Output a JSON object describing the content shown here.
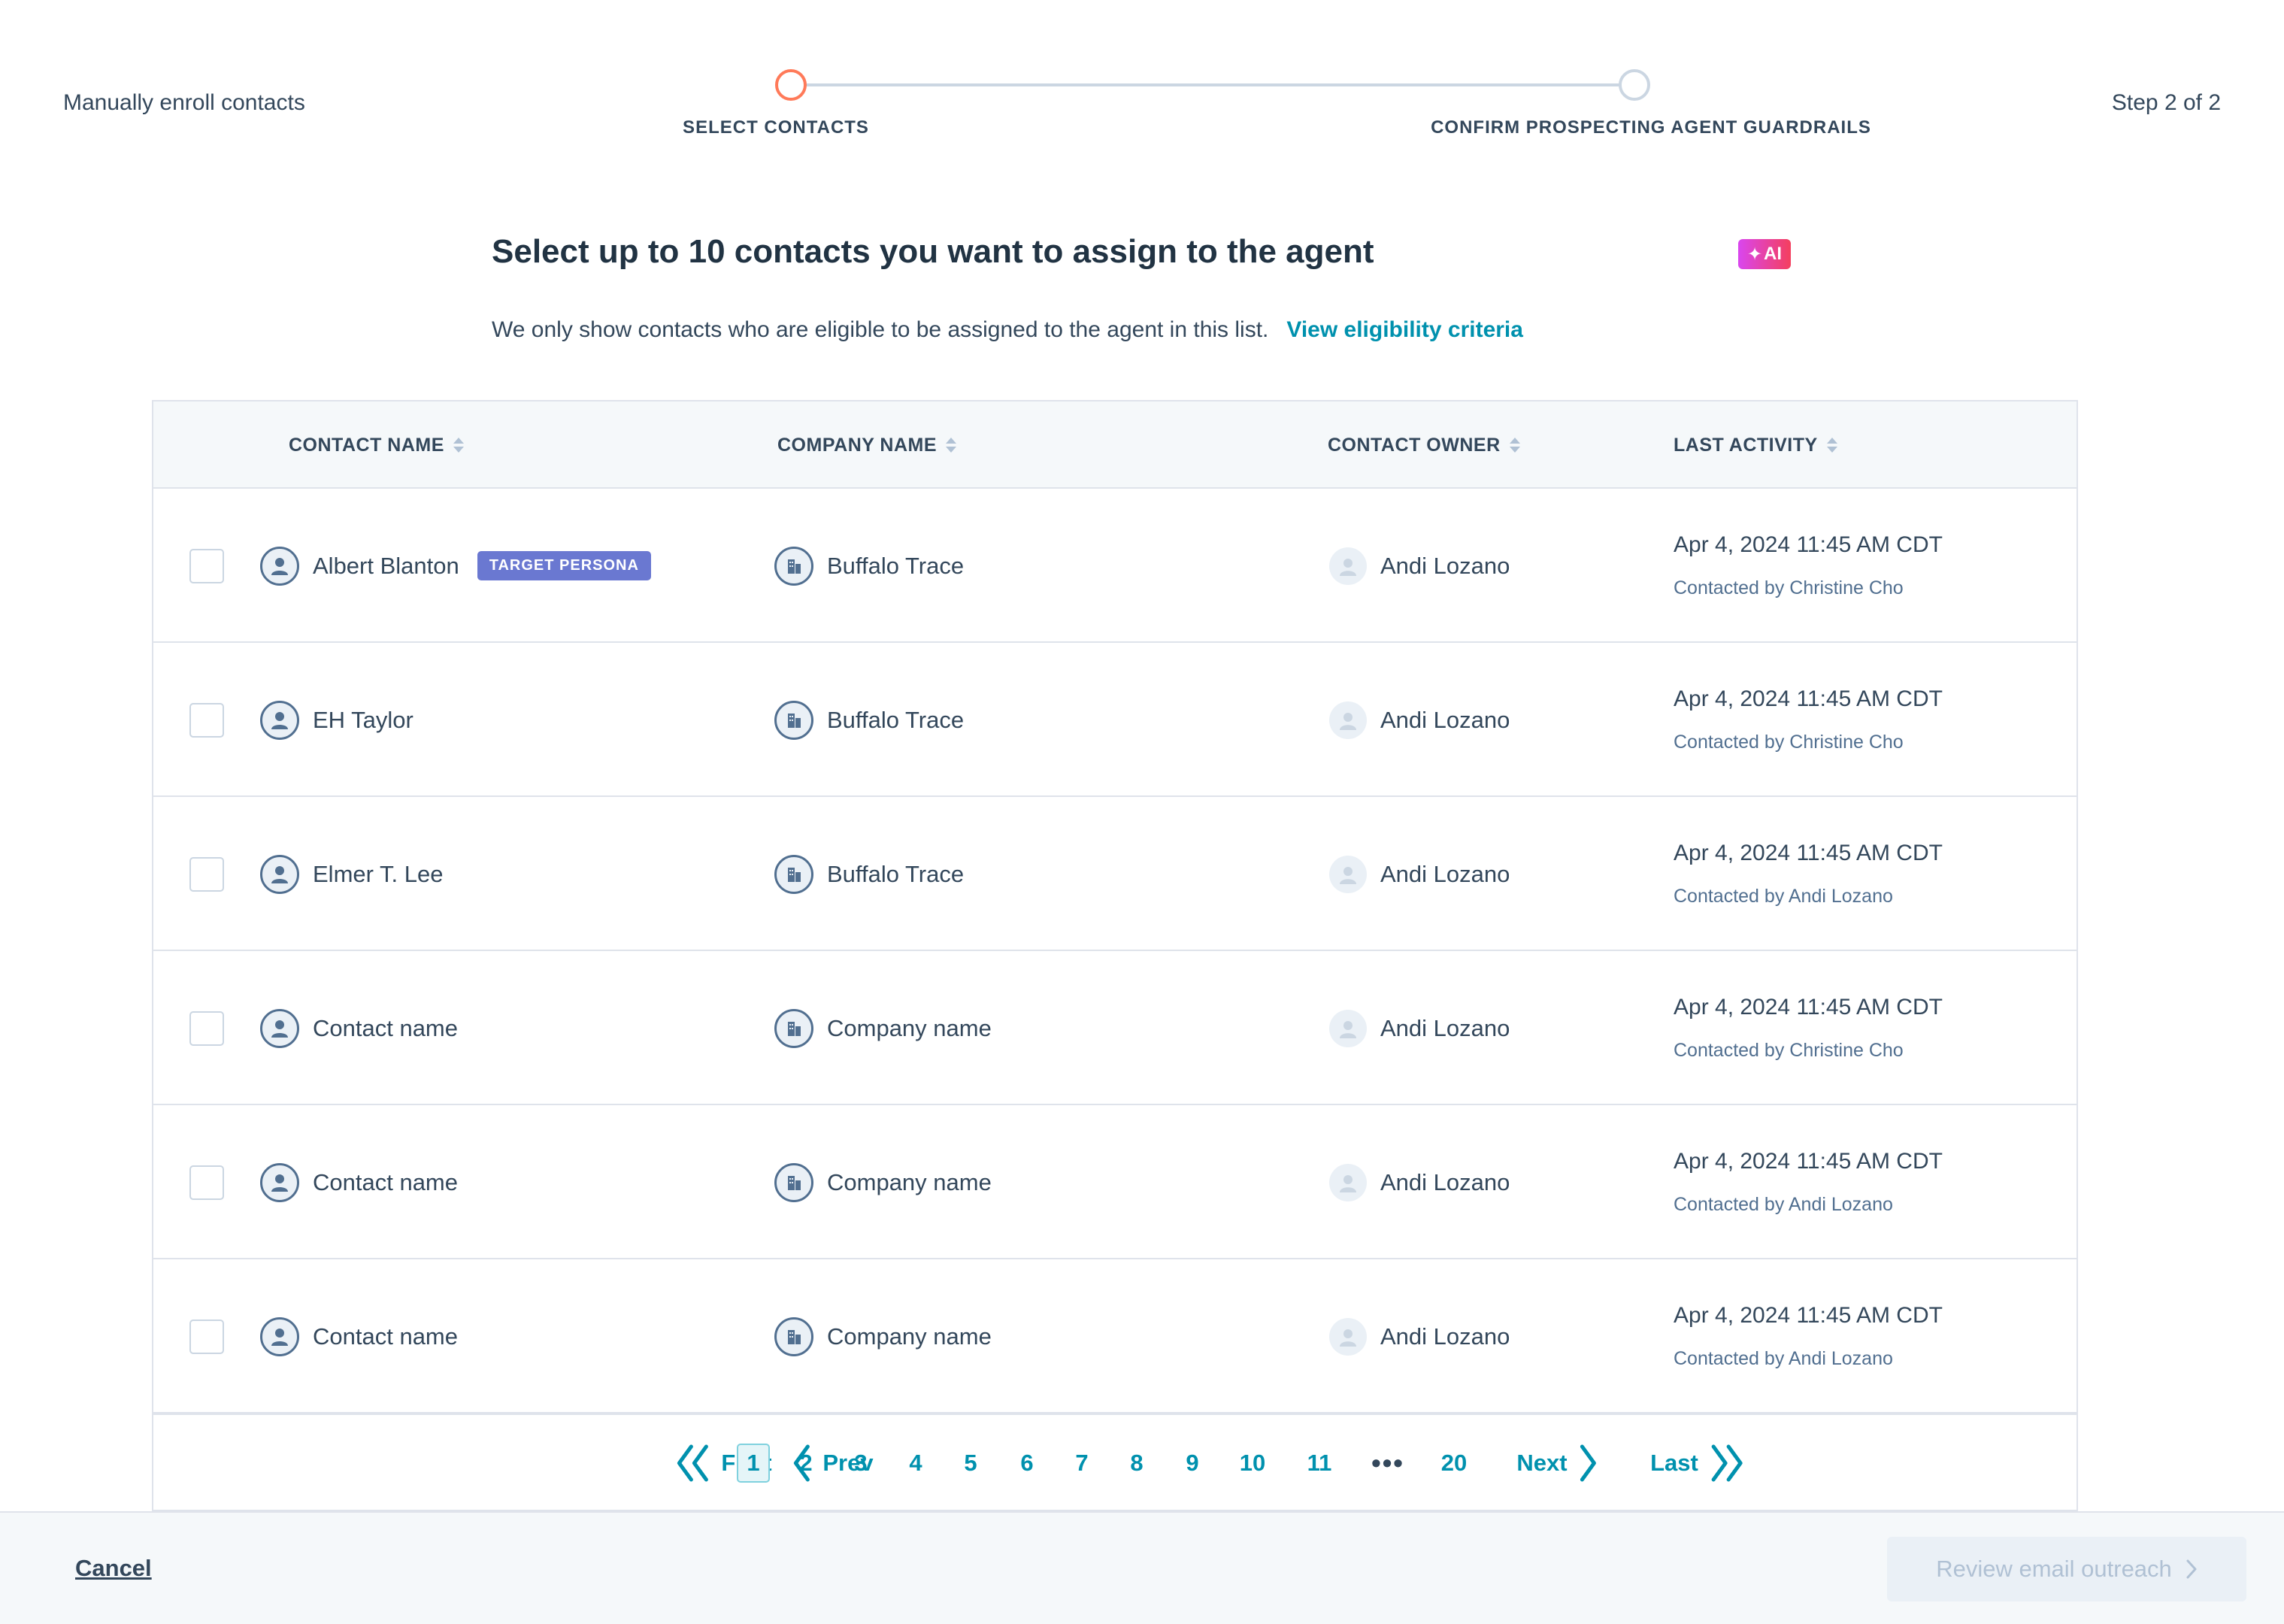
{
  "header": {
    "flow_title": "Manually enroll contacts",
    "step_count": "Step 2 of 2",
    "steps": [
      {
        "label": "SELECT CONTACTS"
      },
      {
        "label": "CONFIRM PROSPECTING AGENT GUARDRAILS"
      }
    ]
  },
  "main": {
    "heading": "Select up to 10 contacts you want to assign to the agent",
    "ai_badge": "AI",
    "subtitle": "We only show contacts who are eligible to be assigned to the agent in this list.",
    "eligibility_link": "View eligibility criteria"
  },
  "table": {
    "columns": [
      "CONTACT NAME",
      "COMPANY NAME",
      "CONTACT OWNER",
      "LAST ACTIVITY"
    ],
    "rows": [
      {
        "contact": "Albert Blanton",
        "badge": "TARGET PERSONA",
        "company": "Buffalo Trace",
        "owner": "Andi Lozano",
        "activity_date": "Apr 4, 2024 11:45 AM CDT",
        "activity_by": "Contacted by Christine Cho"
      },
      {
        "contact": "EH Taylor",
        "company": "Buffalo Trace",
        "owner": "Andi Lozano",
        "activity_date": "Apr 4, 2024 11:45 AM CDT",
        "activity_by": "Contacted by Christine Cho"
      },
      {
        "contact": "Elmer T. Lee",
        "company": "Buffalo Trace",
        "owner": "Andi Lozano",
        "activity_date": "Apr 4, 2024 11:45 AM CDT",
        "activity_by": "Contacted by Andi Lozano"
      },
      {
        "contact": "Contact name",
        "company": "Company name",
        "owner": "Andi Lozano",
        "activity_date": "Apr 4, 2024 11:45 AM CDT",
        "activity_by": "Contacted by Christine Cho"
      },
      {
        "contact": "Contact name",
        "company": "Company name",
        "owner": "Andi Lozano",
        "activity_date": "Apr 4, 2024 11:45 AM CDT",
        "activity_by": "Contacted by Andi Lozano"
      },
      {
        "contact": "Contact name",
        "company": "Company name",
        "owner": "Andi Lozano",
        "activity_date": "Apr 4, 2024 11:45 AM CDT",
        "activity_by": "Contacted by Andi Lozano"
      }
    ]
  },
  "pagination": {
    "first": "First",
    "prev": "Prev",
    "pages": [
      "1",
      "2",
      "3",
      "4",
      "5",
      "6",
      "7",
      "8",
      "9",
      "10",
      "11"
    ],
    "ellipsis": "•••",
    "last_page": "20",
    "next": "Next",
    "last": "Last",
    "current": "1"
  },
  "footer": {
    "cancel": "Cancel",
    "review": "Review email outreach"
  },
  "colors": {
    "accent": "#0091ae",
    "active_step": "#ff7a59",
    "persona_badge": "#6a78d1"
  },
  "icons": {
    "contact": "person-icon",
    "company": "building-icon",
    "owner": "avatar-icon",
    "sort": "sort-icon",
    "first": "double-chevron-left-icon",
    "prev": "chevron-left-icon",
    "next": "chevron-right-icon",
    "last": "double-chevron-right-icon",
    "review": "chevron-right-icon"
  }
}
